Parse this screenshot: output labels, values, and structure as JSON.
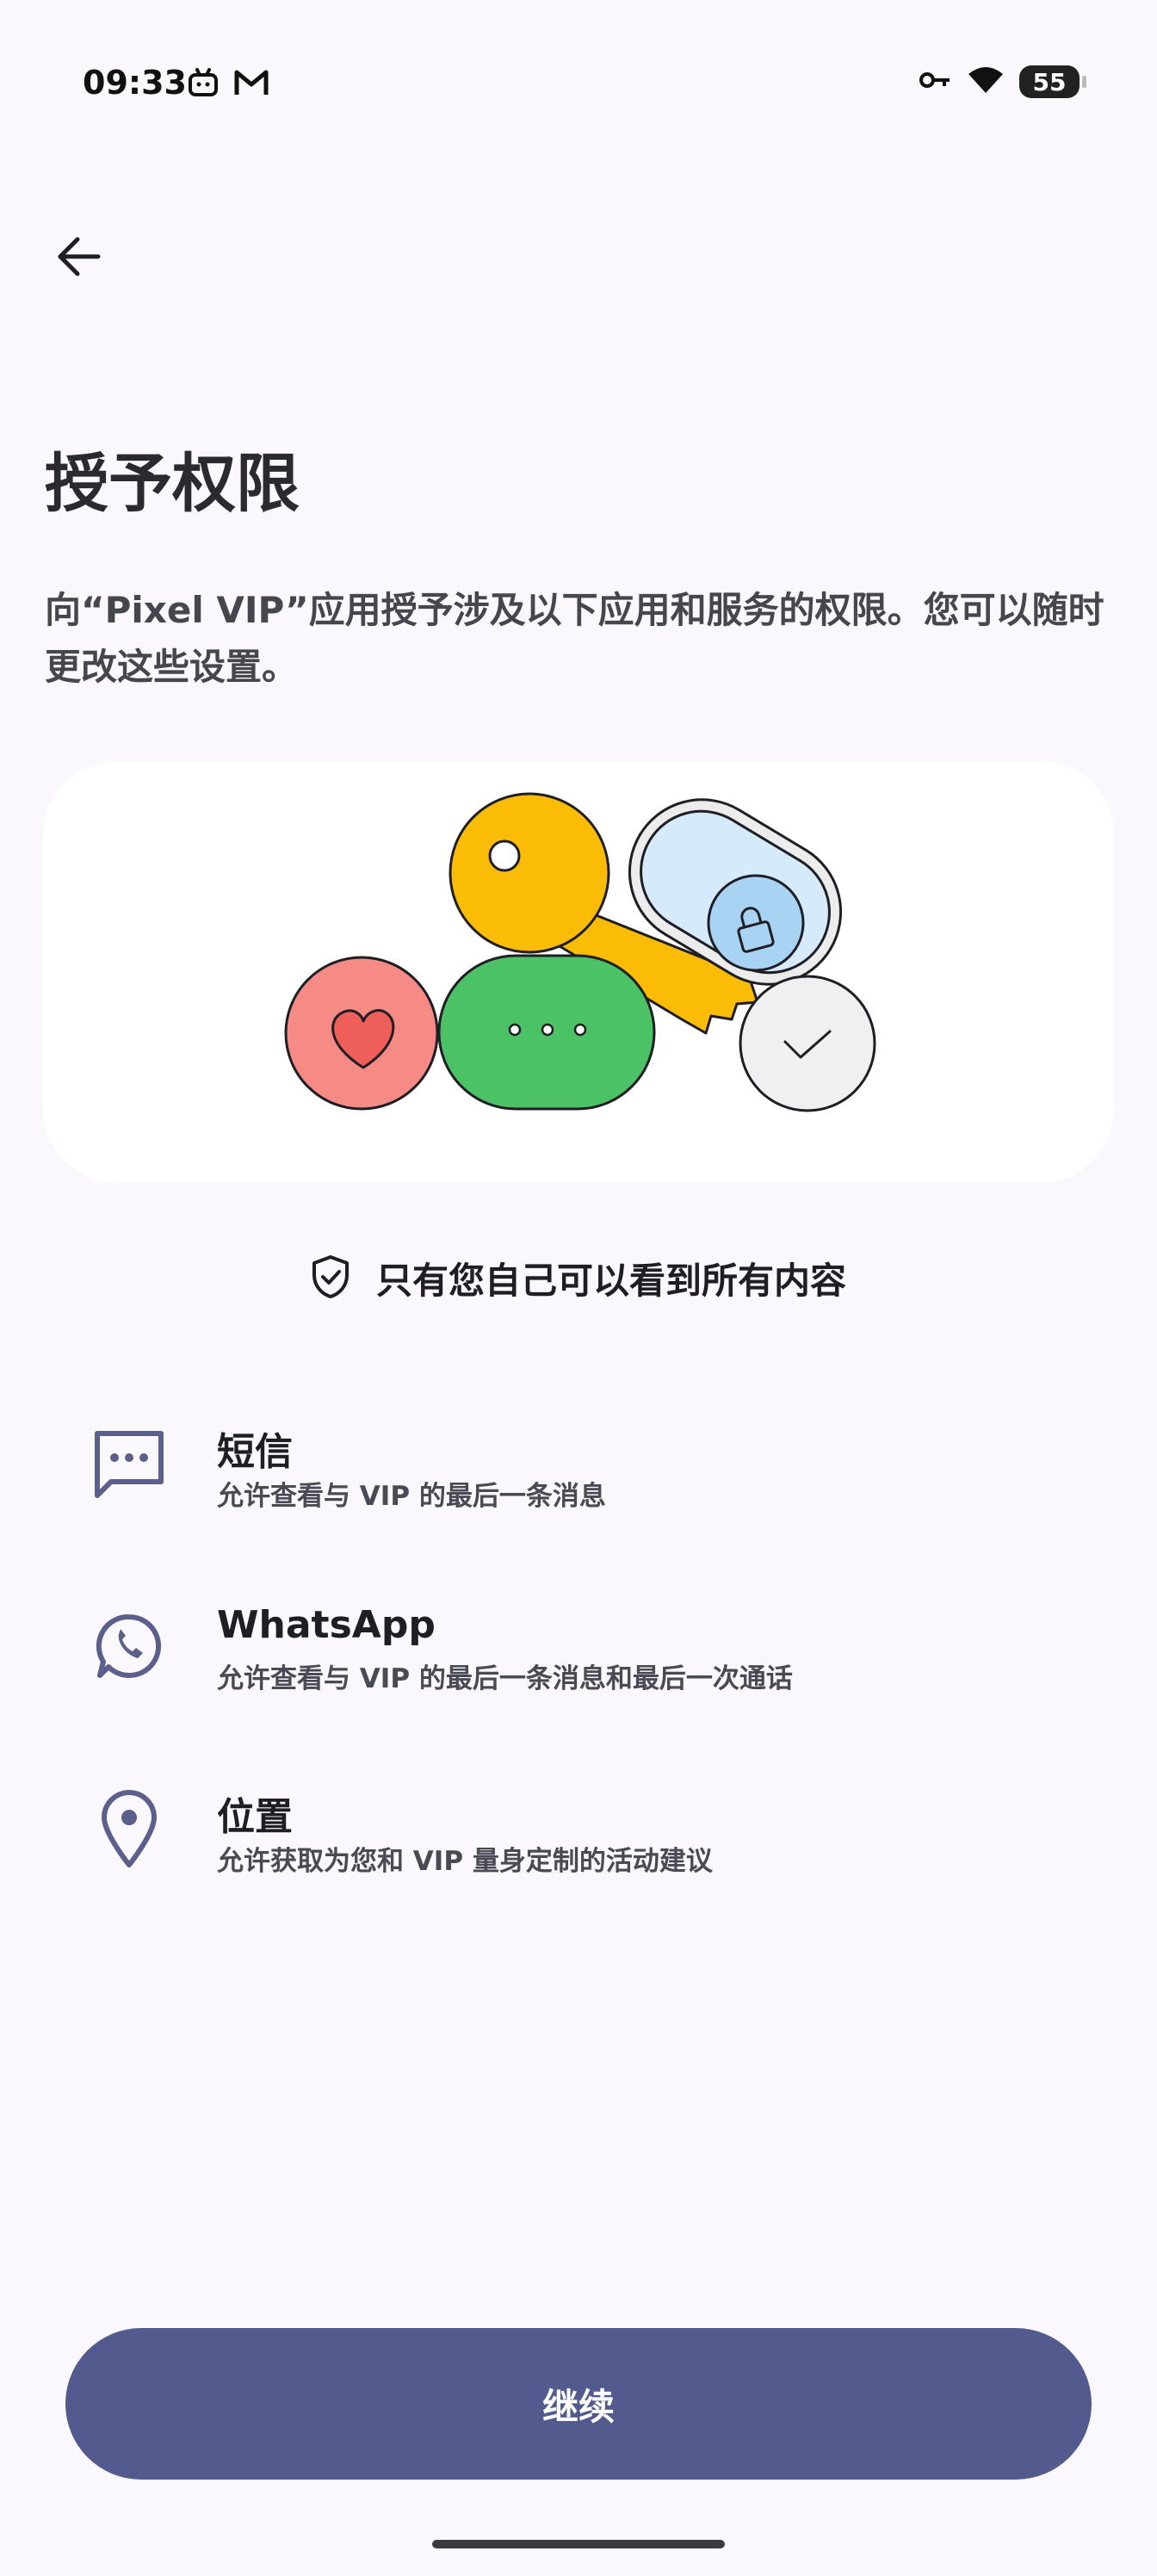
{
  "status_bar": {
    "time": "09:33",
    "battery_level": "55",
    "left_icons": [
      "bilibili-icon",
      "gmail-icon"
    ],
    "right_icons": [
      "vpn-key-icon",
      "wifi-icon",
      "battery-icon"
    ]
  },
  "header": {
    "back_icon": "arrow-back-icon"
  },
  "main": {
    "title": "授予权限",
    "description": "向“Pixel VIP”应用授予涉及以下应用和服务的权限。您可以随时更改这些设置。",
    "privacy_note": "只有您自己可以看到所有内容",
    "privacy_icon": "shield-check-icon"
  },
  "permissions": [
    {
      "title": "短信",
      "description": "允许查看与 VIP 的最后一条消息",
      "icon": "message-icon"
    },
    {
      "title": "WhatsApp",
      "description": "允许查看与 VIP 的最后一条消息和最后一次通话",
      "icon": "whatsapp-icon"
    },
    {
      "title": "位置",
      "description": "允许获取为您和 VIP 量身定制的活动建议",
      "icon": "location-pin-icon"
    }
  ],
  "footer": {
    "continue_label": "继续"
  },
  "colors": {
    "background": "#fbf8fd",
    "primary": "#535a8d",
    "icon_tint": "#5a5f8c",
    "illustration_yellow": "#fbbc05",
    "illustration_green": "#4bc265",
    "illustration_red": "#f68b86",
    "illustration_blue": "#d5ebfb"
  }
}
